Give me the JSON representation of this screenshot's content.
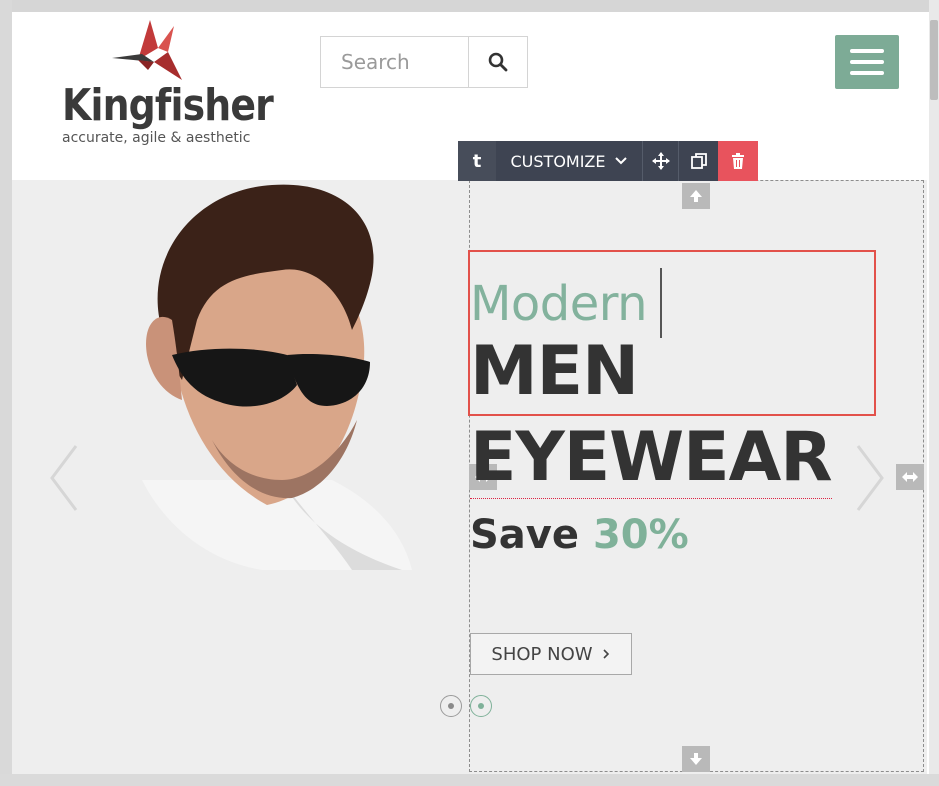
{
  "logo": {
    "name": "Kingfisher",
    "tagline": "accurate, agile & aesthetic"
  },
  "search": {
    "placeholder": "Search",
    "icon": "search-icon"
  },
  "menu": {
    "icon": "hamburger-icon"
  },
  "editor_toolbar": {
    "text_button": "t",
    "customize_label": "CUSTOMIZE",
    "icons": [
      "chevron-down-icon",
      "move-icon",
      "duplicate-icon",
      "trash-icon"
    ]
  },
  "hero": {
    "title_light": "Modern",
    "title_line1": "MEN",
    "title_line2": "EYEWEAR",
    "save_prefix": "Save",
    "save_percent": "30%",
    "cta_label": "SHOP NOW",
    "cta_icon": "chevron-right-icon"
  },
  "slider": {
    "slide_count": 2,
    "active_index": 1
  },
  "colors": {
    "accent": "#7dab96",
    "danger": "#e8535d",
    "toolbar": "#3e4452",
    "selection": "#e2514a"
  }
}
